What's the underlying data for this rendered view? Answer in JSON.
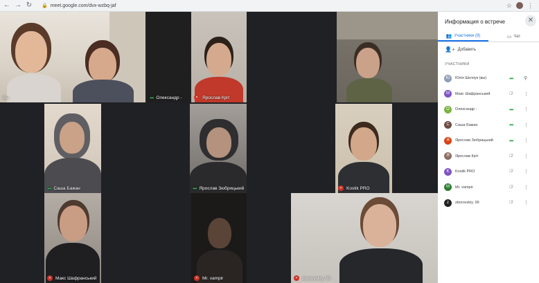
{
  "browser": {
    "back_icon": "arrow-left-icon",
    "forward_icon": "arrow-right-icon",
    "reload_icon": "reload-icon",
    "url": "meet.google.com/dvx-wzbq-jaf"
  },
  "tiles": [
    {
      "name": "Вы",
      "status": "none"
    },
    {
      "name": "Олександр -",
      "status": "speaking"
    },
    {
      "name": "Ярослав Кріт",
      "status": "mic-off"
    },
    {
      "name": "",
      "status": "none"
    },
    {
      "name": "Саша Бажан",
      "status": "speaking"
    },
    {
      "name": "Ярослав Зюбрицький",
      "status": "speaking"
    },
    {
      "name": "Kostik PRO",
      "status": "mic-off"
    },
    {
      "name": "Макс Шафранський",
      "status": "mic-off"
    },
    {
      "name": "Mr. vampir",
      "status": "mic-off"
    },
    {
      "name": "zborovskiy. 99",
      "status": "mic-off"
    }
  ],
  "panel": {
    "title": "Информация о встрече",
    "tab_participants": "Участники (9)",
    "tab_chat": "Чат",
    "add_label": "Добавить",
    "section_label": "УЧАСТНИКИ",
    "participants": [
      {
        "initial": "Ю",
        "name": "Юлія Шкляук (вы)",
        "color": "#8d9db6",
        "status": "dots",
        "action": "pin-icon"
      },
      {
        "initial": "М",
        "name": "Макс Шафранський",
        "color": "#7e57c2",
        "status": "mic-off",
        "action": "more-icon"
      },
      {
        "initial": "О",
        "name": "Олександр -",
        "color": "#7cb342",
        "status": "dots",
        "action": "more-icon"
      },
      {
        "initial": "С",
        "name": "Саша Бажан",
        "color": "#6d4c41",
        "status": "dots",
        "action": "more-icon"
      },
      {
        "initial": "Я",
        "name": "Ярослав Зюбрицький",
        "color": "#d84315",
        "status": "dots",
        "action": "more-icon"
      },
      {
        "initial": "Я",
        "name": "Ярослав Кріт",
        "color": "#8d6e63",
        "status": "mic-off",
        "action": "more-icon"
      },
      {
        "initial": "K",
        "name": "Kostik PRO",
        "color": "#7e57c2",
        "status": "mic-off",
        "action": "more-icon"
      },
      {
        "initial": "M",
        "name": "Mr. vampir",
        "color": "#2e7d32",
        "status": "mic-off",
        "action": "more-icon"
      },
      {
        "initial": "z",
        "name": "zborovskiy. 99",
        "color": "#212121",
        "status": "mic-off",
        "action": "more-icon"
      }
    ]
  }
}
